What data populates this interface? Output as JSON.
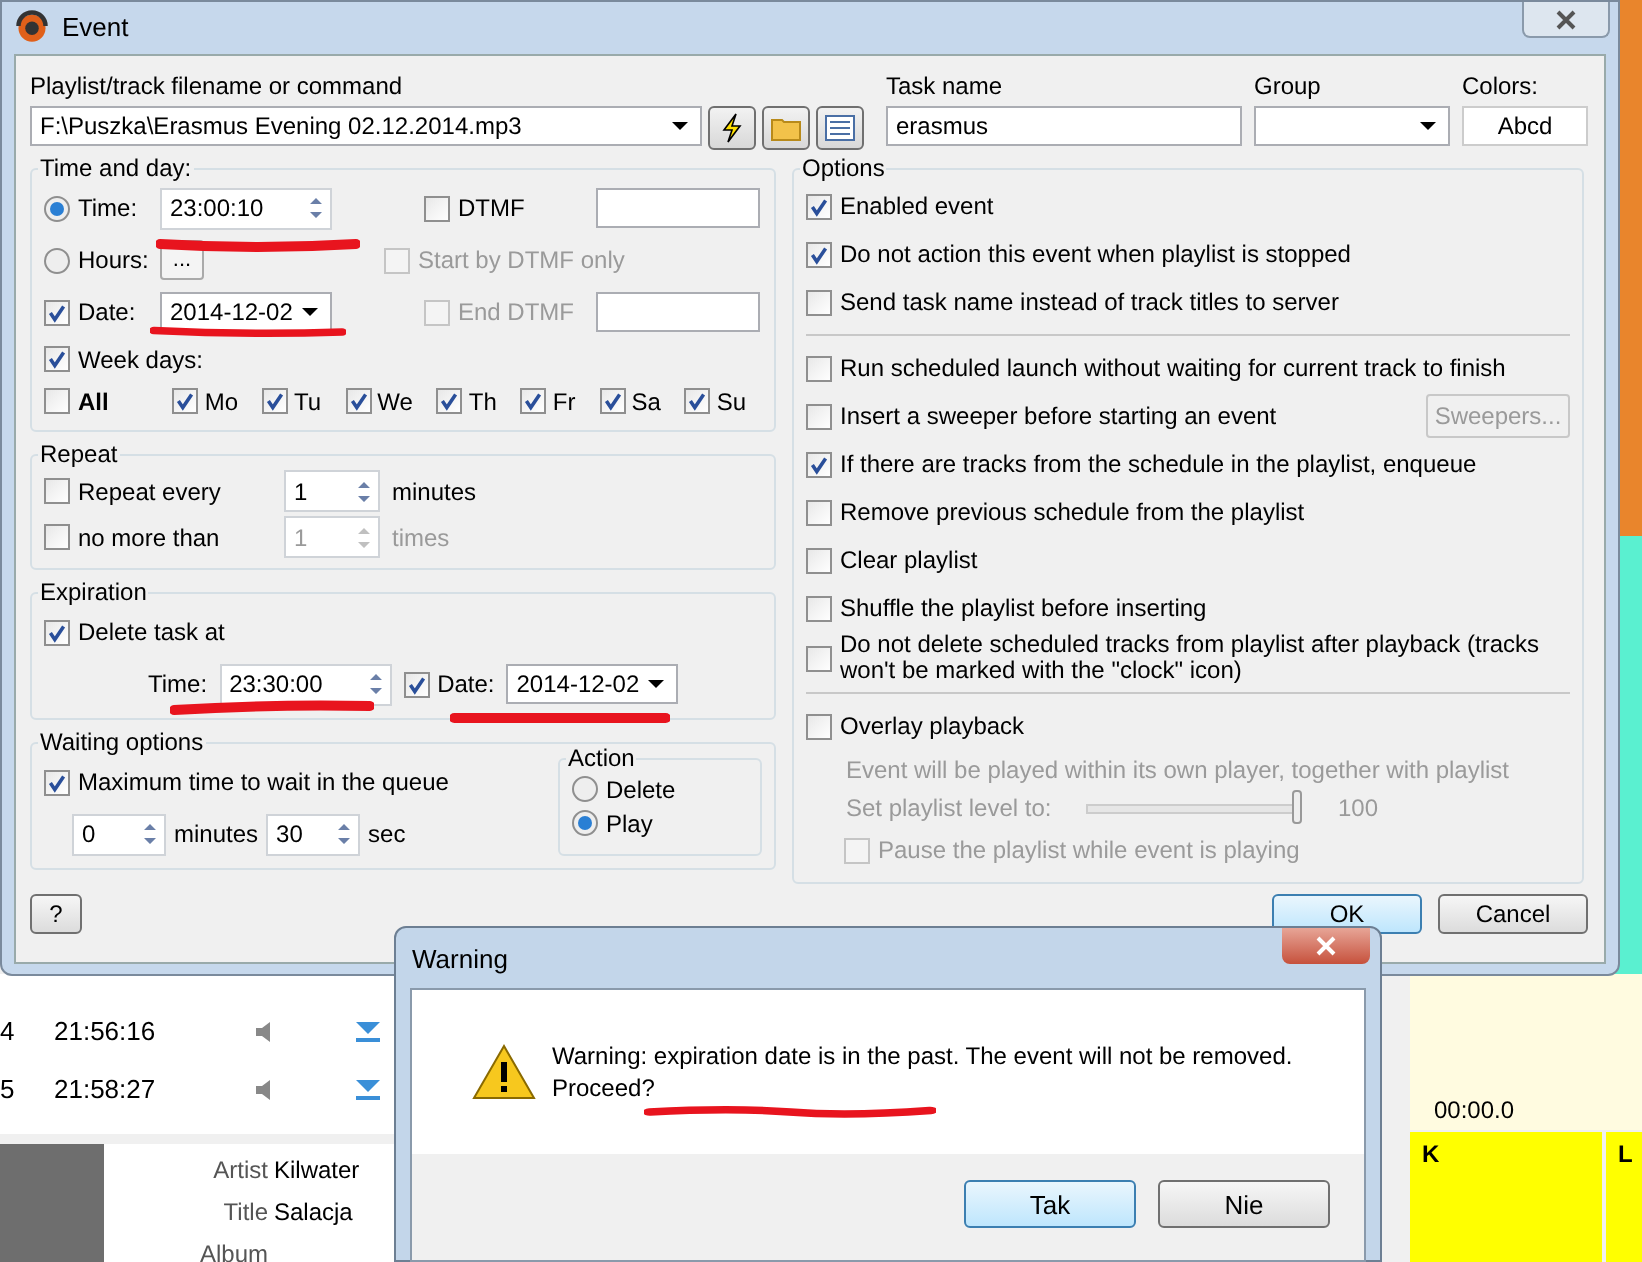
{
  "background": {
    "rows": [
      {
        "number": "4",
        "time": "21:56:16"
      },
      {
        "number": "5",
        "time": "21:58:27"
      }
    ],
    "info": [
      {
        "label": "Artist",
        "value": "Kilwater"
      },
      {
        "label": "Title",
        "value": "Salacja"
      },
      {
        "label": "Album"
      }
    ],
    "timer": "00:00.0",
    "pads": [
      "K",
      "L"
    ]
  },
  "event_window": {
    "title": "Event",
    "file": {
      "label": "Playlist/track filename or command",
      "value": "F:\\Puszka\\Erasmus Evening 02.12.2014.mp3"
    },
    "task": {
      "label": "Task name",
      "value": "erasmus"
    },
    "group": {
      "label": "Group"
    },
    "colors": {
      "label": "Colors:",
      "sample": "Abcd"
    },
    "time_and_day": {
      "title": "Time and day:",
      "time": {
        "label": "Time:",
        "selected": true,
        "value": "23:00:10"
      },
      "hours": {
        "label": "Hours:",
        "selected": false,
        "button": "..."
      },
      "date": {
        "label": "Date:",
        "checked": true,
        "value": "2014-12-02"
      },
      "week_days": {
        "label": "Week days:",
        "checked": true
      },
      "all": {
        "label": "All",
        "checked": false
      },
      "days": [
        {
          "label": "Mo",
          "checked": true
        },
        {
          "label": "Tu",
          "checked": true
        },
        {
          "label": "We",
          "checked": true
        },
        {
          "label": "Th",
          "checked": true
        },
        {
          "label": "Fr",
          "checked": true
        },
        {
          "label": "Sa",
          "checked": true
        },
        {
          "label": "Su",
          "checked": true
        }
      ],
      "dtmf": {
        "label": "DTMF",
        "checked": false,
        "disabled": false
      },
      "start_by_dtmf": {
        "label": "Start by DTMF only",
        "checked": false,
        "disabled": true
      },
      "end_dtmf": {
        "label": "End DTMF",
        "checked": false,
        "disabled": true
      }
    },
    "repeat": {
      "title": "Repeat",
      "every": {
        "label": "Repeat every",
        "checked": false,
        "value": "1",
        "unit": "minutes",
        "disabled": false
      },
      "limit": {
        "label": "no more than",
        "checked": false,
        "value": "1",
        "unit": "times",
        "disabled": true
      }
    },
    "expiration": {
      "title": "Expiration",
      "delete": {
        "label": "Delete task at",
        "checked": true
      },
      "time": {
        "label": "Time:",
        "value": "23:30:00"
      },
      "date": {
        "label": "Date:",
        "checked": true,
        "value": "2014-12-02"
      }
    },
    "waiting": {
      "title": "Waiting options",
      "max": {
        "label": "Maximum time to wait in the queue",
        "checked": true
      },
      "minutes": {
        "value": "0",
        "unit": "minutes"
      },
      "seconds": {
        "value": "30",
        "unit": "sec"
      },
      "action": {
        "title": "Action",
        "options": [
          {
            "label": "Delete",
            "selected": false
          },
          {
            "label": "Play",
            "selected": true
          }
        ]
      }
    },
    "options": {
      "title": "Options",
      "sections": [
        {
          "items": [
            {
              "kind": "check",
              "label": "Enabled event",
              "checked": true,
              "disabled": false
            },
            {
              "kind": "check",
              "label": "Do not action this event when playlist is stopped",
              "checked": true,
              "disabled": false
            },
            {
              "kind": "check",
              "label": "Send task name instead of track titles to server",
              "checked": false,
              "disabled": false
            }
          ]
        },
        {
          "items": [
            {
              "kind": "check",
              "label": "Run scheduled launch without waiting for current track to finish",
              "checked": false,
              "disabled": false
            },
            {
              "kind": "check",
              "label": "Insert a sweeper before starting an event",
              "checked": false,
              "disabled": false,
              "button": "Sweepers..."
            },
            {
              "kind": "check",
              "label": "If there are tracks from the schedule in the playlist, enqueue",
              "checked": true,
              "disabled": false
            },
            {
              "kind": "check",
              "label": "Remove previous schedule from the playlist",
              "checked": false,
              "disabled": false
            },
            {
              "kind": "check",
              "label": "Clear playlist",
              "checked": false,
              "disabled": false
            },
            {
              "kind": "check",
              "label": "Shuffle the playlist before inserting",
              "checked": false,
              "disabled": false
            },
            {
              "kind": "check",
              "label": "Do not delete scheduled tracks from playlist after playback (tracks won't be marked with the \"clock\" icon)",
              "checked": false,
              "disabled": false
            }
          ]
        },
        {
          "items": [
            {
              "kind": "check",
              "label": "Overlay playback",
              "checked": false,
              "disabled": false
            },
            {
              "kind": "note",
              "text": "Event will be played within its own player, together with playlist",
              "disabled": true
            },
            {
              "kind": "slider",
              "label": "Set playlist level to:",
              "level": 1,
              "reading": "100",
              "disabled": true
            },
            {
              "kind": "subcheck",
              "label": "Pause the playlist while event is playing",
              "checked": false,
              "disabled": true
            }
          ]
        }
      ]
    },
    "buttons": {
      "help": "?",
      "ok": "OK",
      "cancel": "Cancel"
    }
  },
  "warning": {
    "title": "Warning",
    "message": "Warning: expiration date is in the past. The event will not be removed. Proceed?",
    "buttons": [
      "Tak",
      "Nie"
    ]
  }
}
